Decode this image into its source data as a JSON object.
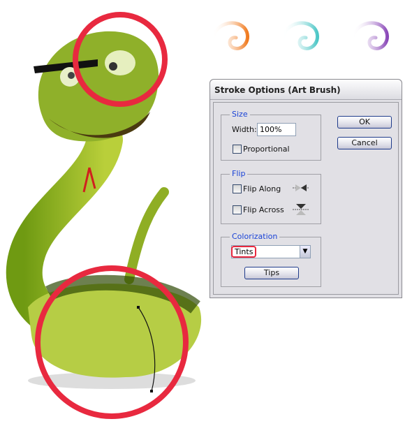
{
  "dialog": {
    "title": "Stroke Options (Art Brush)",
    "size": {
      "legend": "Size",
      "width_label": "Width:",
      "width_value": "100%",
      "proportional_label": "Proportional",
      "proportional_checked": false
    },
    "flip": {
      "legend": "Flip",
      "along_label": "Flip Along",
      "along_checked": false,
      "across_label": "Flip Across",
      "across_checked": false
    },
    "colorization": {
      "legend": "Colorization",
      "method_value": "Tints",
      "tips_label": "Tips"
    },
    "ok_label": "OK",
    "cancel_label": "Cancel"
  },
  "colors": {
    "highlight": "#e8293f",
    "legend_text": "#1a43d6",
    "swirls": [
      "#f07a1e",
      "#4cc6c6",
      "#8a48b8"
    ]
  }
}
